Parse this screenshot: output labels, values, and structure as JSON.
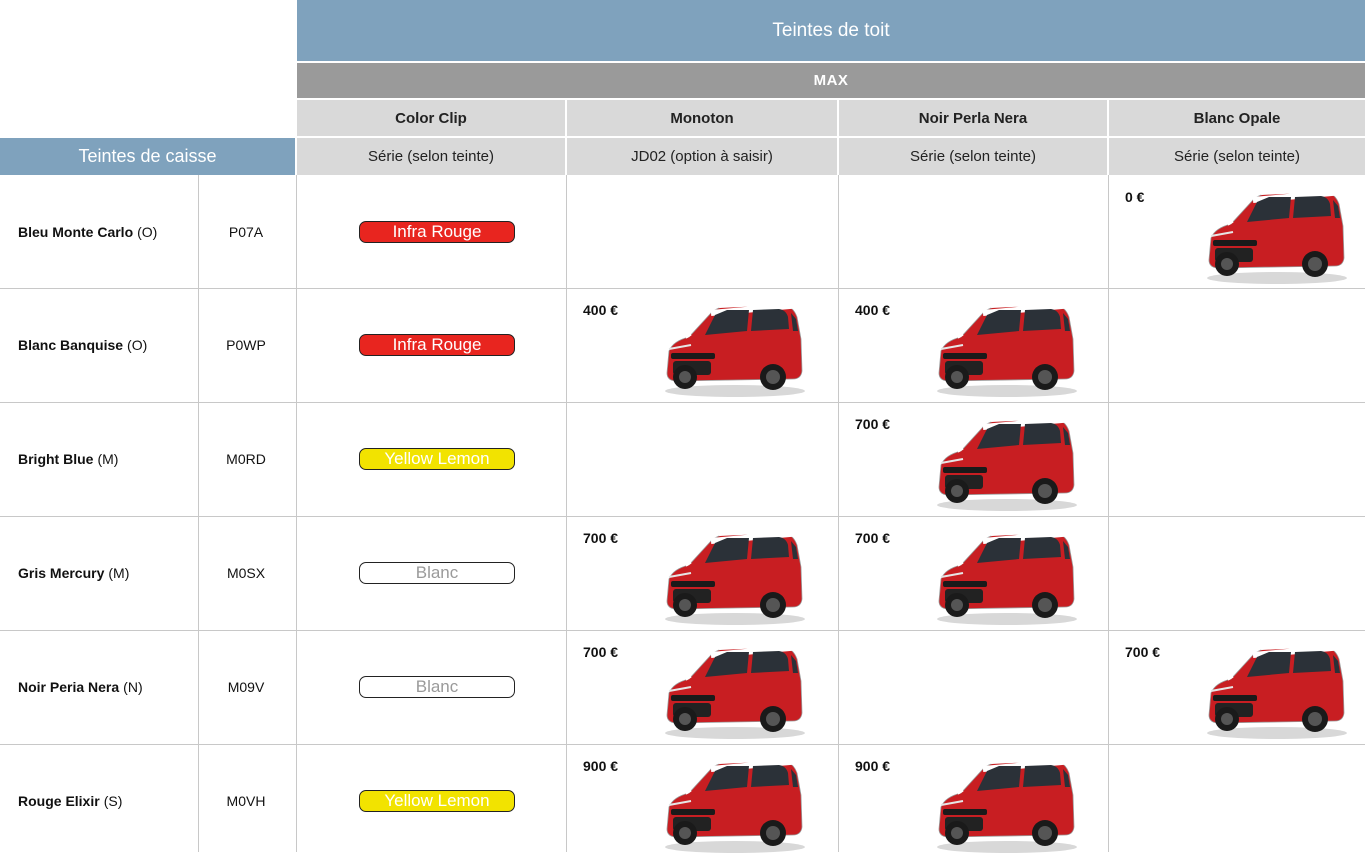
{
  "header": {
    "roof_title": "Teintes de toit",
    "trim": "MAX",
    "body_title": "Teintes de caisse"
  },
  "columns": [
    {
      "name": "Color Clip",
      "serie": "Série (selon teinte)"
    },
    {
      "name": "Monoton",
      "serie": "JD02 (option à saisir)"
    },
    {
      "name": "Noir Perla Nera",
      "serie": "Série (selon teinte)"
    },
    {
      "name": "Blanc Opale",
      "serie": "Série (selon teinte)"
    }
  ],
  "rows": [
    {
      "name": "Bleu Monte Carlo",
      "suffix": "(O)",
      "code": "P07A",
      "clip": {
        "label": "Infra Rouge",
        "style": "red"
      },
      "monoton": "",
      "noir": "",
      "blanc": "0 €",
      "colors": {
        "blanc": "#8fb3c7"
      }
    },
    {
      "name": "Blanc Banquise",
      "suffix": "(O)",
      "code": "P0WP",
      "clip": {
        "label": "Infra Rouge",
        "style": "red"
      },
      "monoton": "400 €",
      "noir": "400 €",
      "blanc": "",
      "colors": {
        "monoton": "#f4f4f4",
        "noir": "#f4f4f4"
      }
    },
    {
      "name": "Bright Blue",
      "suffix": "(M)",
      "code": "M0RD",
      "clip": {
        "label": "Yellow Lemon",
        "style": "yellow"
      },
      "monoton": "",
      "noir": "700 €",
      "blanc": "",
      "colors": {
        "noir": "#1f5fc4"
      }
    },
    {
      "name": "Gris Mercury",
      "suffix": "(M)",
      "code": "M0SX",
      "clip": {
        "label": "Blanc",
        "style": "white"
      },
      "monoton": "700 €",
      "noir": "700 €",
      "blanc": "",
      "colors": {
        "monoton": "#8c9096",
        "noir": "#8c9096"
      }
    },
    {
      "name": "Noir Peria Nera",
      "suffix": "(N)",
      "code": "M09V",
      "clip": {
        "label": "Blanc",
        "style": "white"
      },
      "monoton": "700 €",
      "noir": "",
      "blanc": "700 €",
      "colors": {
        "monoton": "#1c1c1c",
        "blanc": "#1c1c1c"
      }
    },
    {
      "name": "Rouge Elixir",
      "suffix": "(S)",
      "code": "M0VH",
      "clip": {
        "label": "Yellow Lemon",
        "style": "yellow"
      },
      "monoton": "900 €",
      "noir": "900 €",
      "blanc": "",
      "colors": {
        "monoton": "#c81e22",
        "noir": "#c81e22"
      }
    }
  ],
  "palette": {
    "header_blue": "#7fa2bd",
    "header_gray": "#9a9a9a",
    "subheader": "#d9d9d9"
  }
}
